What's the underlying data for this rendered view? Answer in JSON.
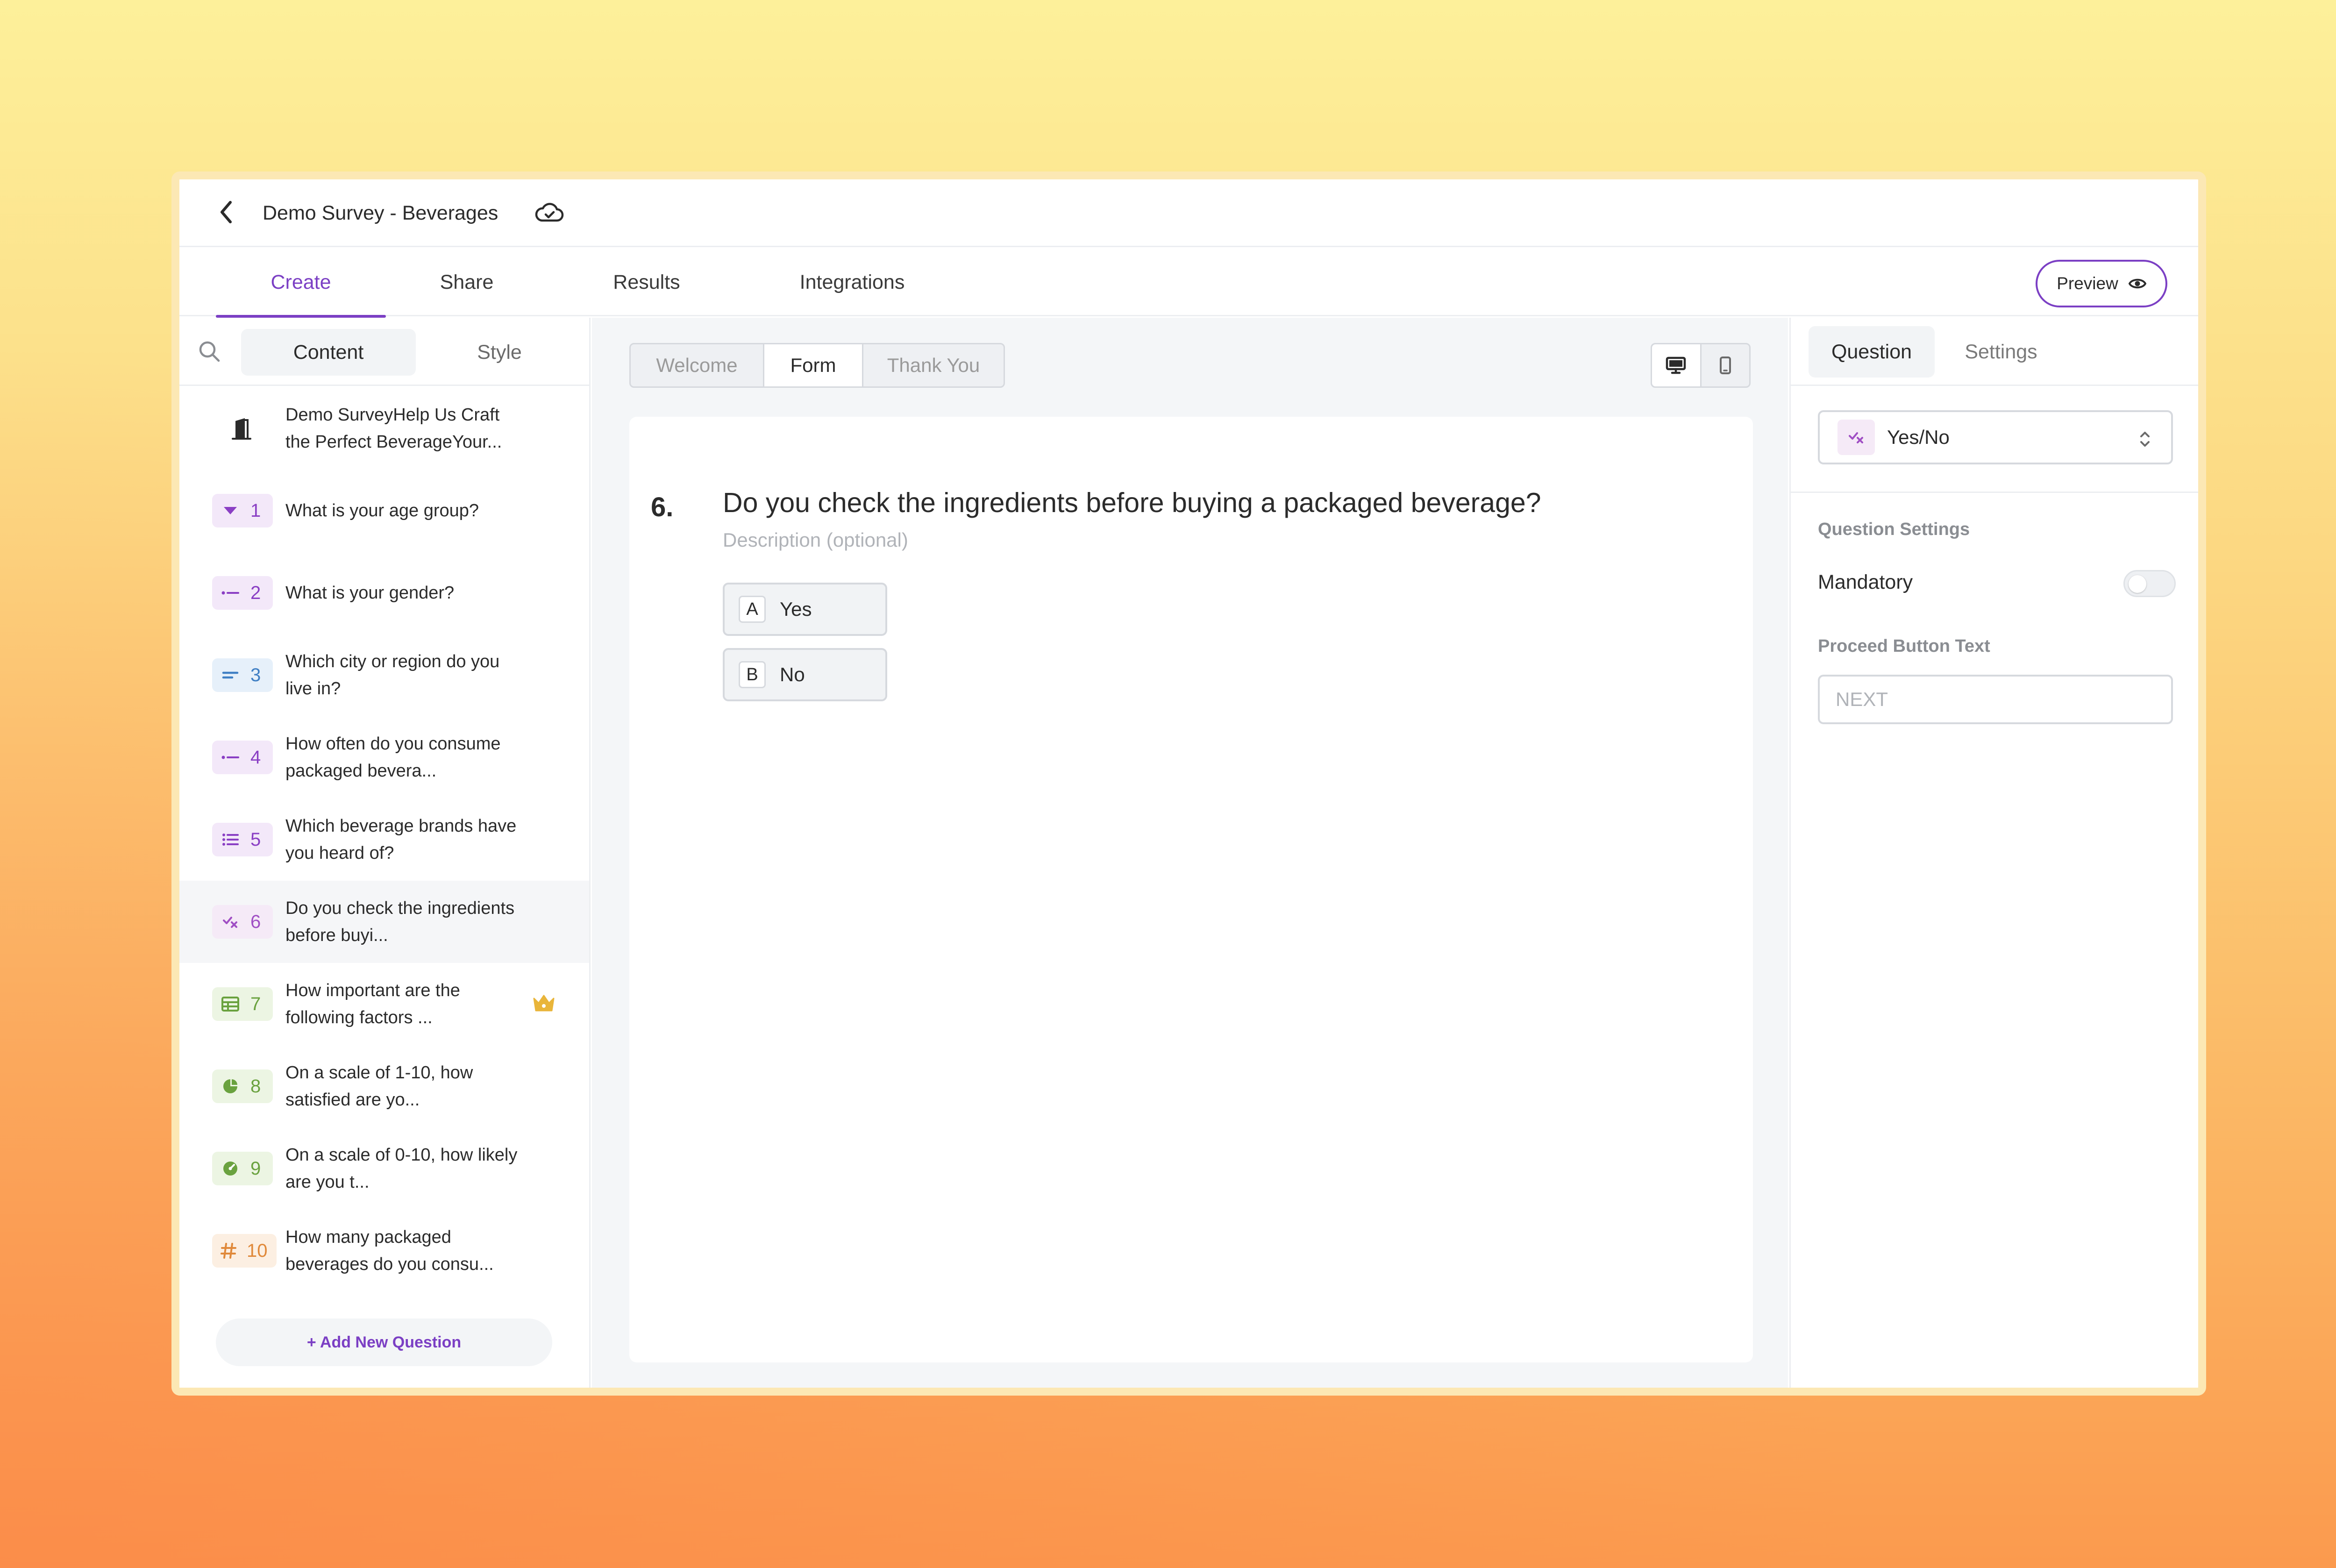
{
  "app": {
    "title": "Demo Survey - Beverages",
    "main_tabs": [
      {
        "label": "Create",
        "active": true
      },
      {
        "label": "Share",
        "active": false
      },
      {
        "label": "Results",
        "active": false
      },
      {
        "label": "Integrations",
        "active": false
      }
    ],
    "preview_label": "Preview",
    "accent_color": "#7b3fc4"
  },
  "sidebar": {
    "tabs": [
      {
        "label": "Content",
        "active": true
      },
      {
        "label": "Style",
        "active": false
      }
    ],
    "header_item": {
      "text": "Demo SurveyHelp Us Craft the Perfect BeverageYour..."
    },
    "questions": [
      {
        "num": "1",
        "text": "What is your age group?",
        "icon": "dropdown-icon",
        "color": "#8a3fc4",
        "bg": "#f3e8f9"
      },
      {
        "num": "2",
        "text": "What is your gender?",
        "icon": "single-choice-icon",
        "color": "#8a3fc4",
        "bg": "#f3e8f9"
      },
      {
        "num": "3",
        "text": "Which city or region do you live in?",
        "icon": "short-text-icon",
        "color": "#3f7fc4",
        "bg": "#e6f0fa"
      },
      {
        "num": "4",
        "text": "How often do you consume packaged bevera...",
        "icon": "single-choice-icon",
        "color": "#8a3fc4",
        "bg": "#f3e8f9"
      },
      {
        "num": "5",
        "text": "Which beverage brands have you heard of?",
        "icon": "multi-choice-icon",
        "color": "#8a3fc4",
        "bg": "#f3e8f9"
      },
      {
        "num": "6",
        "text": "Do you check the ingredients before buyi...",
        "icon": "yes-no-icon",
        "color": "#a04fc4",
        "bg": "#f5eaf7",
        "selected": true
      },
      {
        "num": "7",
        "text": "How important are the following factors ...",
        "icon": "matrix-icon",
        "color": "#6aa23f",
        "bg": "#ecf5e3",
        "premium": true
      },
      {
        "num": "8",
        "text": "On a scale of 1-10, how satisfied are yo...",
        "icon": "rating-icon",
        "color": "#6aa23f",
        "bg": "#ecf5e3"
      },
      {
        "num": "9",
        "text": "On a scale of 0-10, how likely are you t...",
        "icon": "nps-icon",
        "color": "#6aa23f",
        "bg": "#ecf5e3"
      },
      {
        "num": "10",
        "text": "How many packaged beverages do you consu...",
        "icon": "number-icon",
        "color": "#e0893a",
        "bg": "#fcefe2"
      }
    ],
    "add_question_label": "+ Add New Question"
  },
  "center": {
    "segments": [
      {
        "label": "Welcome",
        "active": false
      },
      {
        "label": "Form",
        "active": true
      },
      {
        "label": "Thank You",
        "active": false
      }
    ],
    "question": {
      "number": "6.",
      "title": "Do you check the ingredients before buying a packaged beverage?",
      "description_placeholder": "Description (optional)",
      "options": [
        {
          "key": "A",
          "label": "Yes"
        },
        {
          "key": "B",
          "label": "No"
        }
      ]
    }
  },
  "right_panel": {
    "tabs": [
      {
        "label": "Question",
        "active": true
      },
      {
        "label": "Settings",
        "active": false
      }
    ],
    "question_type": "Yes/No",
    "section_title": "Question Settings",
    "mandatory_label": "Mandatory",
    "mandatory_on": false,
    "proceed_label": "Proceed Button Text",
    "proceed_placeholder": "NEXT"
  }
}
